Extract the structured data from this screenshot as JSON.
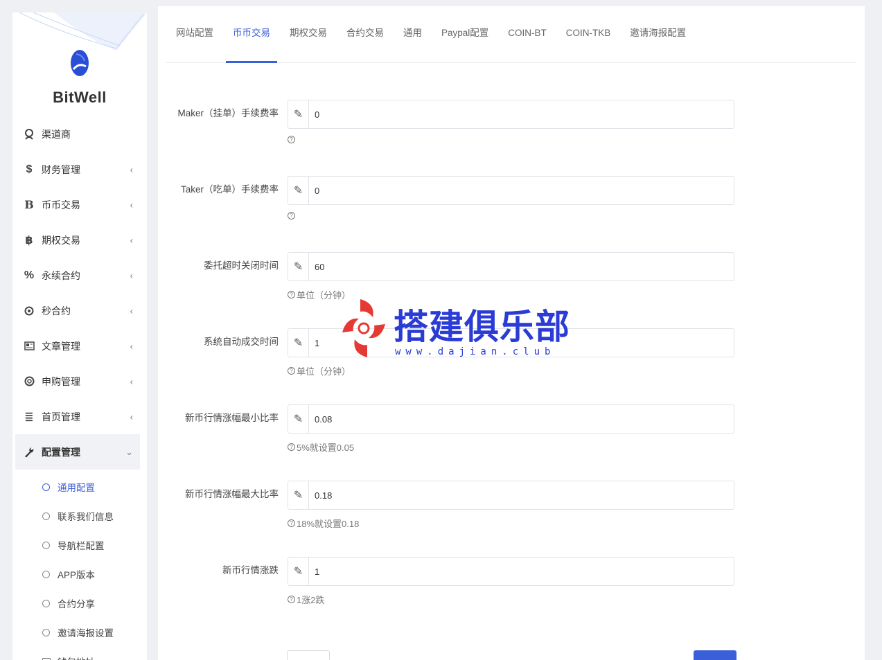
{
  "brand": {
    "name": "BitWell"
  },
  "sidebar": {
    "items": [
      {
        "label": "渠道商",
        "icon": "user-icon",
        "has_children": false
      },
      {
        "label": "财务管理",
        "icon": "dollar-icon",
        "has_children": true
      },
      {
        "label": "币币交易",
        "icon": "bitcoin-b-icon",
        "has_children": true
      },
      {
        "label": "期权交易",
        "icon": "bitcoin-icon",
        "has_children": true
      },
      {
        "label": "永续合约",
        "icon": "percent-icon",
        "has_children": true
      },
      {
        "label": "秒合约",
        "icon": "dot-circle-icon",
        "has_children": true
      },
      {
        "label": "文章管理",
        "icon": "newspaper-icon",
        "has_children": true
      },
      {
        "label": "申购管理",
        "icon": "lifebuoy-icon",
        "has_children": true
      },
      {
        "label": "首页管理",
        "icon": "list-icon",
        "has_children": true
      },
      {
        "label": "配置管理",
        "icon": "wrench-icon",
        "has_children": true,
        "expanded": true
      }
    ],
    "submenu": [
      {
        "label": "通用配置",
        "active": true
      },
      {
        "label": "联系我们信息"
      },
      {
        "label": "导航栏配置"
      },
      {
        "label": "APP版本"
      },
      {
        "label": "合约分享"
      },
      {
        "label": "邀请海报设置"
      },
      {
        "label": "钱包地址"
      }
    ]
  },
  "tabs": [
    {
      "label": "网站配置"
    },
    {
      "label": "币币交易",
      "active": true
    },
    {
      "label": "期权交易"
    },
    {
      "label": "合约交易"
    },
    {
      "label": "通用"
    },
    {
      "label": "Paypal配置"
    },
    {
      "label": "COIN-BT"
    },
    {
      "label": "COIN-TKB"
    },
    {
      "label": "邀请海报配置"
    }
  ],
  "form": [
    {
      "label": "Maker（挂单）手续费率",
      "value": "0",
      "help": ""
    },
    {
      "label": "Taker（吃单）手续费率",
      "value": "0",
      "help": ""
    },
    {
      "label": "委托超时关闭时间",
      "value": "60",
      "help": "单位（分钟）"
    },
    {
      "label": "系统自动成交时间",
      "value": "1",
      "help": "单位（分钟）"
    },
    {
      "label": "新币行情涨幅最小比率",
      "value": "0.08",
      "help": "5%就设置0.05"
    },
    {
      "label": "新币行情涨幅最大比率",
      "value": "0.18",
      "help": "18%就设置0.18"
    },
    {
      "label": "新币行情涨跌",
      "value": "1",
      "help": "1涨2跌"
    }
  ],
  "watermark": {
    "title": "搭建俱乐部",
    "url": "www.dajian.club"
  },
  "colors": {
    "accent": "#3b5fd9",
    "watermark": "#2a3bd6",
    "watermark_logo": "#e53935"
  }
}
